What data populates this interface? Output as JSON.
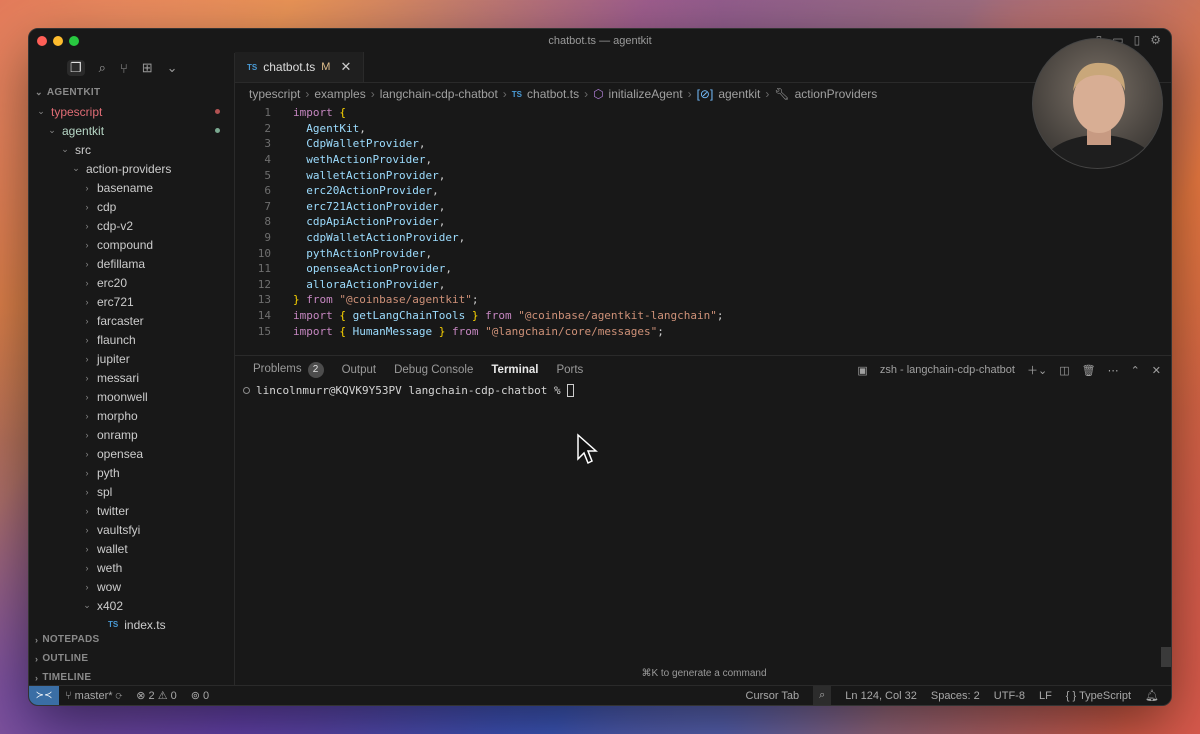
{
  "window": {
    "title": "chatbot.ts — agentkit"
  },
  "sidebar": {
    "root": "AGENTKIT",
    "tree": [
      {
        "label": "typescript",
        "depth": 0,
        "chev": "⌄",
        "cls": "git-mod",
        "dot": "#b25252"
      },
      {
        "label": "agentkit",
        "depth": 1,
        "chev": "⌄",
        "cls": "git-mod2",
        "dot": "#7aa890"
      },
      {
        "label": "src",
        "depth": 2,
        "chev": "⌄",
        "cls": ""
      },
      {
        "label": "action-providers",
        "depth": 3,
        "chev": "⌄",
        "cls": ""
      },
      {
        "label": "basename",
        "depth": 4,
        "chev": "›",
        "cls": ""
      },
      {
        "label": "cdp",
        "depth": 4,
        "chev": "›",
        "cls": ""
      },
      {
        "label": "cdp-v2",
        "depth": 4,
        "chev": "›",
        "cls": ""
      },
      {
        "label": "compound",
        "depth": 4,
        "chev": "›",
        "cls": ""
      },
      {
        "label": "defillama",
        "depth": 4,
        "chev": "›",
        "cls": ""
      },
      {
        "label": "erc20",
        "depth": 4,
        "chev": "›",
        "cls": ""
      },
      {
        "label": "erc721",
        "depth": 4,
        "chev": "›",
        "cls": ""
      },
      {
        "label": "farcaster",
        "depth": 4,
        "chev": "›",
        "cls": ""
      },
      {
        "label": "flaunch",
        "depth": 4,
        "chev": "›",
        "cls": ""
      },
      {
        "label": "jupiter",
        "depth": 4,
        "chev": "›",
        "cls": ""
      },
      {
        "label": "messari",
        "depth": 4,
        "chev": "›",
        "cls": ""
      },
      {
        "label": "moonwell",
        "depth": 4,
        "chev": "›",
        "cls": ""
      },
      {
        "label": "morpho",
        "depth": 4,
        "chev": "›",
        "cls": ""
      },
      {
        "label": "onramp",
        "depth": 4,
        "chev": "›",
        "cls": ""
      },
      {
        "label": "opensea",
        "depth": 4,
        "chev": "›",
        "cls": ""
      },
      {
        "label": "pyth",
        "depth": 4,
        "chev": "›",
        "cls": ""
      },
      {
        "label": "spl",
        "depth": 4,
        "chev": "›",
        "cls": ""
      },
      {
        "label": "twitter",
        "depth": 4,
        "chev": "›",
        "cls": ""
      },
      {
        "label": "vaultsfyi",
        "depth": 4,
        "chev": "›",
        "cls": ""
      },
      {
        "label": "wallet",
        "depth": 4,
        "chev": "›",
        "cls": ""
      },
      {
        "label": "weth",
        "depth": 4,
        "chev": "›",
        "cls": ""
      },
      {
        "label": "wow",
        "depth": 4,
        "chev": "›",
        "cls": ""
      },
      {
        "label": "x402",
        "depth": 4,
        "chev": "⌄",
        "cls": ""
      },
      {
        "label": "index.ts",
        "depth": 5,
        "chev": "",
        "cls": "",
        "ts": "TS"
      }
    ],
    "bottom_sections": [
      "NOTEPADS",
      "OUTLINE",
      "TIMELINE"
    ]
  },
  "editor": {
    "tab": {
      "lang": "TS",
      "name": "chatbot.ts",
      "status": "M",
      "close": "✕"
    },
    "breadcrumb": [
      "typescript",
      "examples",
      "langchain-cdp-chatbot",
      "chatbot.ts",
      "initializeAgent",
      "agentkit",
      "actionProviders"
    ],
    "code": [
      [
        [
          "kw",
          "import"
        ],
        [
          "punc",
          " "
        ],
        [
          "brace",
          "{"
        ]
      ],
      [
        [
          "ident",
          "  AgentKit"
        ],
        [
          "punc",
          ","
        ]
      ],
      [
        [
          "ident",
          "  CdpWalletProvider"
        ],
        [
          "punc",
          ","
        ]
      ],
      [
        [
          "ident",
          "  wethActionProvider"
        ],
        [
          "punc",
          ","
        ]
      ],
      [
        [
          "ident",
          "  walletActionProvider"
        ],
        [
          "punc",
          ","
        ]
      ],
      [
        [
          "ident",
          "  erc20ActionProvider"
        ],
        [
          "punc",
          ","
        ]
      ],
      [
        [
          "ident",
          "  erc721ActionProvider"
        ],
        [
          "punc",
          ","
        ]
      ],
      [
        [
          "ident",
          "  cdpApiActionProvider"
        ],
        [
          "punc",
          ","
        ]
      ],
      [
        [
          "ident",
          "  cdpWalletActionProvider"
        ],
        [
          "punc",
          ","
        ]
      ],
      [
        [
          "ident",
          "  pythActionProvider"
        ],
        [
          "punc",
          ","
        ]
      ],
      [
        [
          "ident",
          "  openseaActionProvider"
        ],
        [
          "punc",
          ","
        ]
      ],
      [
        [
          "ident",
          "  alloraActionProvider"
        ],
        [
          "punc",
          ","
        ]
      ],
      [
        [
          "brace",
          "}"
        ],
        [
          "punc",
          " "
        ],
        [
          "kw",
          "from"
        ],
        [
          "punc",
          " "
        ],
        [
          "str",
          "\"@coinbase/agentkit\""
        ],
        [
          "punc",
          ";"
        ]
      ],
      [
        [
          "kw",
          "import"
        ],
        [
          "punc",
          " "
        ],
        [
          "brace",
          "{"
        ],
        [
          "punc",
          " "
        ],
        [
          "ident",
          "getLangChainTools"
        ],
        [
          "punc",
          " "
        ],
        [
          "brace",
          "}"
        ],
        [
          "punc",
          " "
        ],
        [
          "kw",
          "from"
        ],
        [
          "punc",
          " "
        ],
        [
          "str",
          "\"@coinbase/agentkit-langchain\""
        ],
        [
          "punc",
          ";"
        ]
      ],
      [
        [
          "kw",
          "import"
        ],
        [
          "punc",
          " "
        ],
        [
          "brace",
          "{"
        ],
        [
          "punc",
          " "
        ],
        [
          "ident",
          "HumanMessage"
        ],
        [
          "punc",
          " "
        ],
        [
          "brace",
          "}"
        ],
        [
          "punc",
          " "
        ],
        [
          "kw",
          "from"
        ],
        [
          "punc",
          " "
        ],
        [
          "str",
          "\"@langchain/core/messages\""
        ],
        [
          "punc",
          ";"
        ]
      ]
    ]
  },
  "panel": {
    "tabs": [
      "Problems",
      "Output",
      "Debug Console",
      "Terminal",
      "Ports"
    ],
    "problems_count": "2",
    "active_tab": "Terminal",
    "terminal_name": "zsh - langchain-cdp-chatbot",
    "prompt": "lincolnmurr@KQVK9Y53PV langchain-cdp-chatbot %",
    "hint": "⌘K to generate a command"
  },
  "statusbar": {
    "branch": "master*",
    "errors": "2",
    "warnings": "0",
    "ports": "0",
    "cursor_tab": "Cursor Tab",
    "position": "Ln 124, Col 32",
    "spaces": "Spaces: 2",
    "encoding": "UTF-8",
    "eol": "LF",
    "language": "TypeScript"
  }
}
